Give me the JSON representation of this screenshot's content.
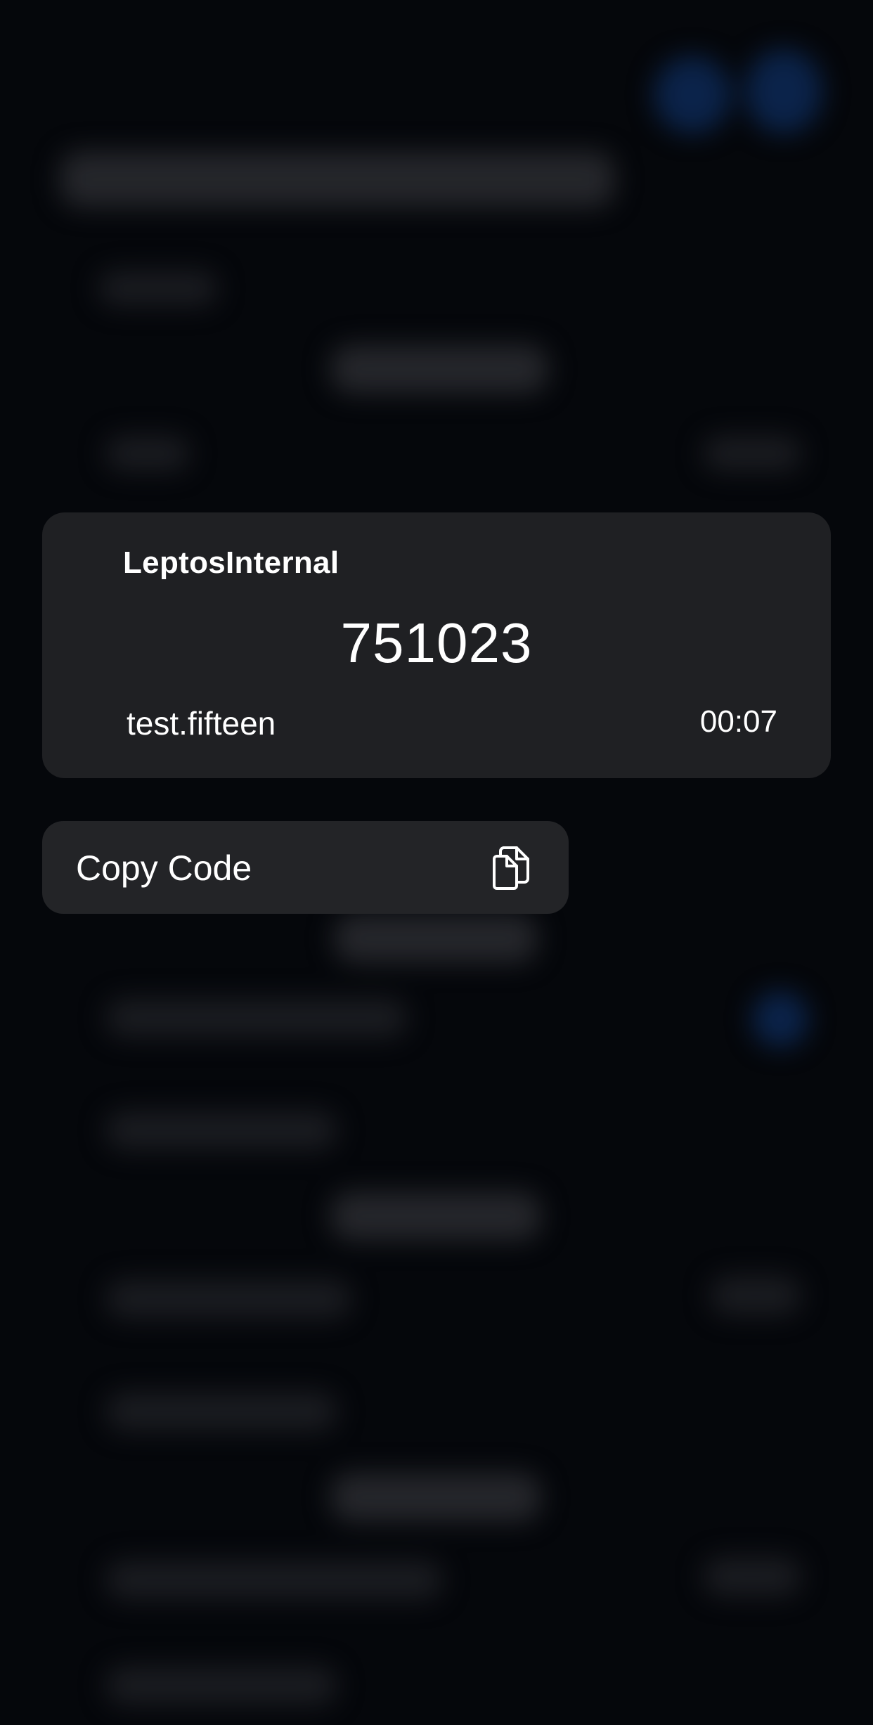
{
  "otp_card": {
    "issuer": "LeptosInternal",
    "code": "751023",
    "account": "test.fifteen",
    "timer": "00:07"
  },
  "context_menu": {
    "copy_label": "Copy Code",
    "copy_icon": "copy-icon"
  },
  "colors": {
    "background": "#05070b",
    "card": "#1f2023",
    "menu_item": "#232427",
    "text": "#ffffff"
  }
}
